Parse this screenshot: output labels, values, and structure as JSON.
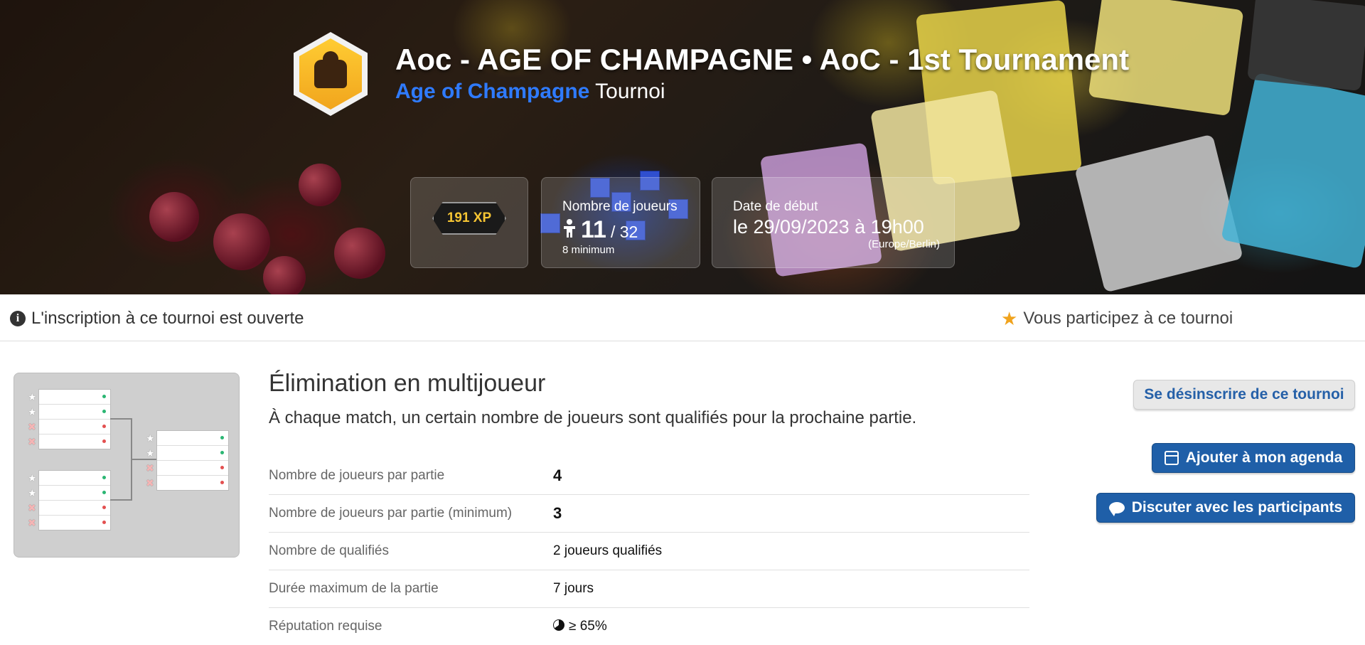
{
  "header": {
    "title": "Aoc - AGE OF CHAMPAGNE • AoC - 1st Tournament",
    "game_name": "Age of Champagne",
    "subtitle_suffix": "Tournoi",
    "logo_icon": "meeple-hex-logo-icon"
  },
  "stats": {
    "xp": "191 XP",
    "players_label": "Nombre de joueurs",
    "players_count": "11",
    "players_max": "/ 32",
    "players_min": "8 minimum",
    "date_label": "Date de début",
    "date_value": "le 29/09/2023 à 19h00",
    "timezone": "(Europe/Berlin)"
  },
  "status": {
    "registration": "L'inscription à ce tournoi est ouverte",
    "participating": "Vous participez à ce tournoi",
    "info_icon": "info-circle-icon",
    "star_icon": "star-icon",
    "star_color": "#f0a31d"
  },
  "format": {
    "title": "Élimination en multijoueur",
    "description": "À chaque match, un certain nombre de joueurs sont qualifiés pour la prochaine partie."
  },
  "details": [
    {
      "label": "Nombre de joueurs par partie",
      "value": "4"
    },
    {
      "label": "Nombre de joueurs par partie (minimum)",
      "value": "3"
    },
    {
      "label": "Nombre de qualifiés",
      "value": "2 joueurs qualifiés"
    },
    {
      "label": "Durée maximum de la partie",
      "value": "7 jours"
    },
    {
      "label": "Réputation requise",
      "value": "≥ 65%"
    }
  ],
  "buttons": {
    "unregister": "Se désinscrire de ce tournoi",
    "add_agenda": "Ajouter à mon agenda",
    "chat": "Discuter avec les participants",
    "accent_color": "#1f5fa8"
  }
}
